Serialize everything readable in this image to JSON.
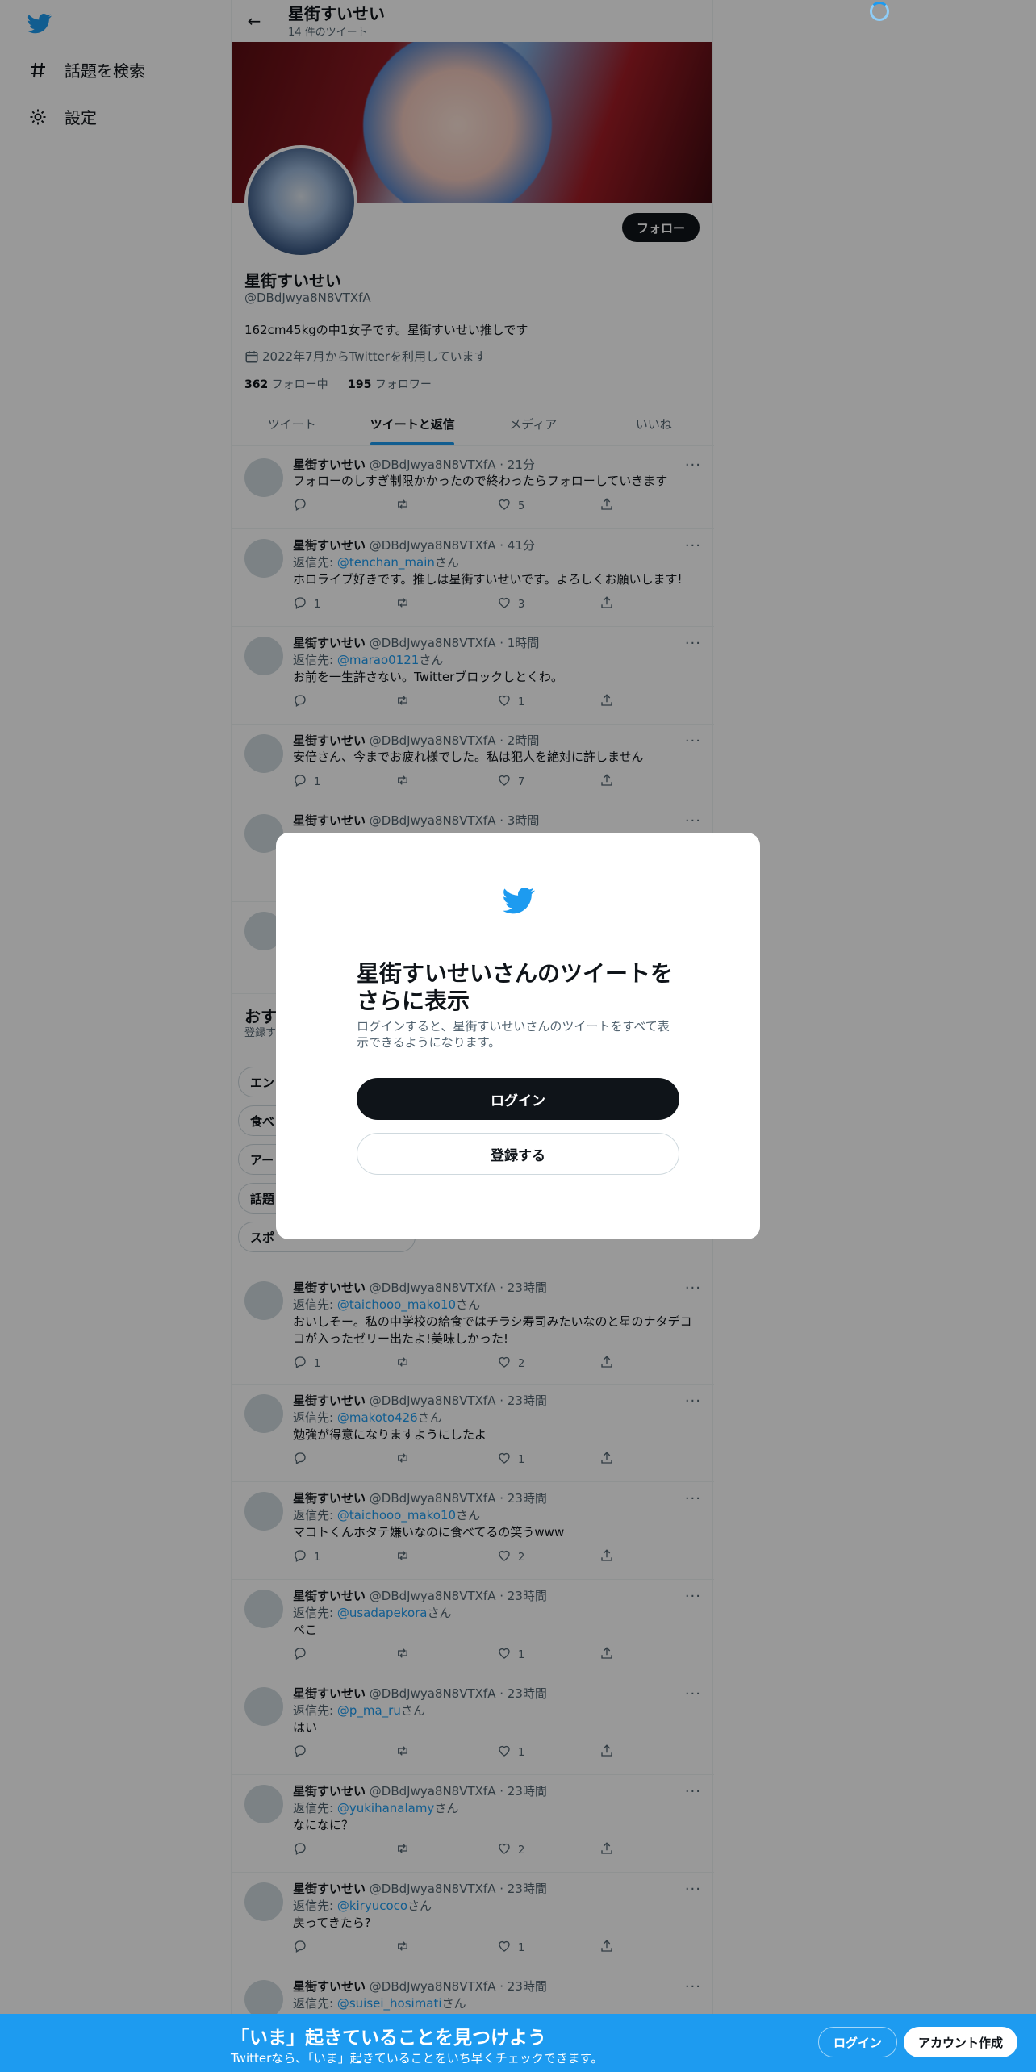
{
  "sidebar": {
    "logo_icon": "twitter-bird-icon",
    "items": [
      {
        "icon": "hashtag-icon",
        "label": "話題を検索"
      },
      {
        "icon": "gear-icon",
        "label": "設定"
      }
    ]
  },
  "header": {
    "back_icon": "arrow-left-icon",
    "title": "星街すいせい",
    "subtitle": "14 件のツイート"
  },
  "profile": {
    "follow_label": "フォロー",
    "name": "星街すいせい",
    "handle": "@DBdJwya8N8VTXfA",
    "bio": "162cm45kgの中1女子です。星街すいせい推しです",
    "joined": "2022年7月からTwitterを利用しています",
    "following_count": "362",
    "following_label": " フォロー中",
    "followers_count": "195",
    "followers_label": " フォロワー"
  },
  "tabs": [
    {
      "label": "ツイート",
      "active": false
    },
    {
      "label": "ツイートと返信",
      "active": true
    },
    {
      "label": "メディア",
      "active": false
    },
    {
      "label": "いいね",
      "active": false
    }
  ],
  "tweets": [
    {
      "name": "星街すいせい",
      "handle": "@DBdJwya8N8VTXfA",
      "time": "21分",
      "reply_to": "",
      "text": "フォローのしすぎ制限かかったので終わったらフォローしていきます",
      "replies": "",
      "retweets": "",
      "likes": "5"
    },
    {
      "name": "星街すいせい",
      "handle": "@DBdJwya8N8VTXfA",
      "time": "41分",
      "reply_to": "@tenchan_main",
      "text": "ホロライブ好きです。推しは星街すいせいです。よろしくお願いします!",
      "replies": "1",
      "retweets": "",
      "likes": "3"
    },
    {
      "name": "星街すいせい",
      "handle": "@DBdJwya8N8VTXfA",
      "time": "1時間",
      "reply_to": "@marao0121",
      "text": "お前を一生許さない。Twitterブロックしとくわ。",
      "replies": "",
      "retweets": "",
      "likes": "1"
    },
    {
      "name": "星街すいせい",
      "handle": "@DBdJwya8N8VTXfA",
      "time": "2時間",
      "reply_to": "",
      "text": "安倍さん、今までお疲れ様でした。私は犯人を絶対に許しません",
      "replies": "1",
      "retweets": "",
      "likes": "7"
    },
    {
      "name": "星街すいせい",
      "handle": "@DBdJwya8N8VTXfA",
      "time": "3時間",
      "reply_to": "",
      "text": "",
      "replies": "",
      "retweets": "",
      "likes": ""
    },
    {
      "name": "",
      "handle": "",
      "time": "",
      "reply_to": "",
      "text": "",
      "replies": "",
      "retweets": "",
      "likes": ""
    },
    {
      "name": "星街すいせい",
      "handle": "@DBdJwya8N8VTXfA",
      "time": "23時間",
      "reply_to": "@taichooo_mako10",
      "text": "おいしそー。私の中学校の給食ではチラシ寿司みたいなのと星のナタデココが入ったゼリー出たよ!美味しかった!",
      "replies": "1",
      "retweets": "",
      "likes": "2"
    },
    {
      "name": "星街すいせい",
      "handle": "@DBdJwya8N8VTXfA",
      "time": "23時間",
      "reply_to": "@makoto426",
      "text": "勉強が得意になりますようにしたよ",
      "replies": "",
      "retweets": "",
      "likes": "1"
    },
    {
      "name": "星街すいせい",
      "handle": "@DBdJwya8N8VTXfA",
      "time": "23時間",
      "reply_to": "@taichooo_mako10",
      "text": "マコトくんホタテ嫌いなのに食べてるの笑うwww",
      "replies": "1",
      "retweets": "",
      "likes": "2"
    },
    {
      "name": "星街すいせい",
      "handle": "@DBdJwya8N8VTXfA",
      "time": "23時間",
      "reply_to": "@usadapekora",
      "text": "ぺこ",
      "replies": "",
      "retweets": "",
      "likes": "1"
    },
    {
      "name": "星街すいせい",
      "handle": "@DBdJwya8N8VTXfA",
      "time": "23時間",
      "reply_to": "@p_ma_ru",
      "text": "はい",
      "replies": "",
      "retweets": "",
      "likes": "1"
    },
    {
      "name": "星街すいせい",
      "handle": "@DBdJwya8N8VTXfA",
      "time": "23時間",
      "reply_to": "@yukihanalamy",
      "text": "なになに？",
      "replies": "",
      "retweets": "",
      "likes": "2"
    },
    {
      "name": "星街すいせい",
      "handle": "@DBdJwya8N8VTXfA",
      "time": "23時間",
      "reply_to": "@kiryucoco",
      "text": "戻ってきたら?",
      "replies": "",
      "retweets": "",
      "likes": "1"
    },
    {
      "name": "星街すいせい",
      "handle": "@DBdJwya8N8VTXfA",
      "time": "23時間",
      "reply_to": "@suisei_hosimati",
      "text": "",
      "replies": "",
      "retweets": "",
      "likes": ""
    }
  ],
  "reply_prefix": "返信先: ",
  "reply_suffix": "さん",
  "suggest": {
    "title": "おす",
    "sub": "登録す",
    "pills": [
      "エン",
      "食べ",
      "アー",
      "話題",
      "スポ"
    ]
  },
  "modal": {
    "logo_icon": "twitter-bird-icon",
    "title": "星街すいせいさんのツイートをさらに表示",
    "description": "ログインすると、星街すいせいさんのツイートをすべて表示できるようになります。",
    "login_label": "ログイン",
    "signup_label": "登録する"
  },
  "bottom_bar": {
    "title": "「いま」起きていることを見つけよう",
    "subtitle": "Twitterなら、「いま」起きていることをいち早くチェックできます。",
    "login_label": "ログイン",
    "signup_label": "アカウント作成"
  },
  "colors": {
    "accent": "#1d9bf0",
    "text": "#0f1419",
    "muted": "#536471"
  }
}
